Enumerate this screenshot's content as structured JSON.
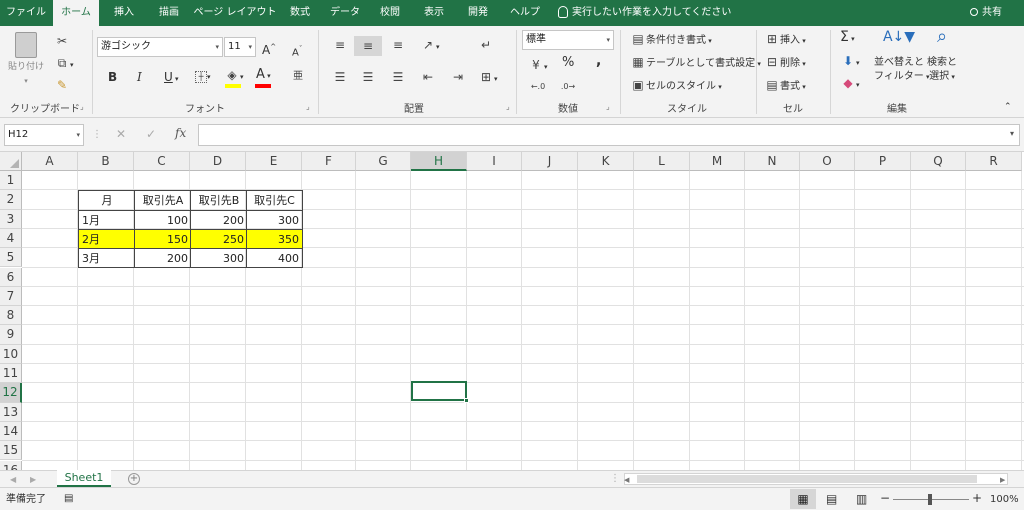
{
  "tabs": [
    {
      "label": "ファイル"
    },
    {
      "label": "ホーム"
    },
    {
      "label": "挿入"
    },
    {
      "label": "描画"
    },
    {
      "label": "ページ レイアウト"
    },
    {
      "label": "数式"
    },
    {
      "label": "データ"
    },
    {
      "label": "校閲"
    },
    {
      "label": "表示"
    },
    {
      "label": "開発"
    },
    {
      "label": "ヘルプ"
    }
  ],
  "active_tab": "ホーム",
  "tell_me": "実行したい作業を入力してください",
  "share": "共有",
  "ribbon": {
    "clipboard": {
      "paste": "貼り付け",
      "label": "クリップボード"
    },
    "font": {
      "name": "游ゴシック",
      "size": "11",
      "bold": "B",
      "italic": "I",
      "underline": "U",
      "grow": "A",
      "shrink": "A",
      "color_letter": "A",
      "label": "フォント"
    },
    "alignment": {
      "label": "配置"
    },
    "number": {
      "format": "標準",
      "percent": "%",
      "comma": ",",
      "label": "数値"
    },
    "styles": {
      "conditional": "条件付き書式",
      "table": "テーブルとして書式設定",
      "cell_styles": "セルのスタイル",
      "label": "スタイル"
    },
    "cells": {
      "insert": "挿入",
      "delete": "削除",
      "format": "書式",
      "label": "セル"
    },
    "editing": {
      "sort_line1": "並べ替えと",
      "sort_line2": "フィルター",
      "find_line1": "検索と",
      "find_line2": "選択",
      "label": "編集"
    }
  },
  "formula_bar": {
    "name_box": "H12",
    "fx": "fx",
    "formula": ""
  },
  "columns": [
    "A",
    "B",
    "C",
    "D",
    "E",
    "F",
    "G",
    "H",
    "I",
    "J",
    "K",
    "L",
    "M",
    "N",
    "O",
    "P",
    "Q",
    "R"
  ],
  "rows": [
    "1",
    "2",
    "3",
    "4",
    "5",
    "6",
    "7",
    "8",
    "9",
    "10",
    "11",
    "12",
    "13",
    "14",
    "15",
    "16"
  ],
  "selected_cell": "H12",
  "table": {
    "headers": [
      "月",
      "取引先A",
      "取引先B",
      "取引先C"
    ],
    "rows": [
      [
        "1月",
        "100",
        "200",
        "300"
      ],
      [
        "2月",
        "150",
        "250",
        "350"
      ],
      [
        "3月",
        "200",
        "300",
        "400"
      ]
    ],
    "highlight_row_index": 1,
    "highlight_color": "#ffff00"
  },
  "sheet_tab": "Sheet1",
  "status": {
    "ready": "準備完了",
    "zoom": "100%"
  },
  "colors": {
    "excel_green": "#217346",
    "ribbon_bg": "#f3f3f3",
    "fill_color_bar": "#ffff00",
    "font_color_bar": "#ff0000"
  }
}
